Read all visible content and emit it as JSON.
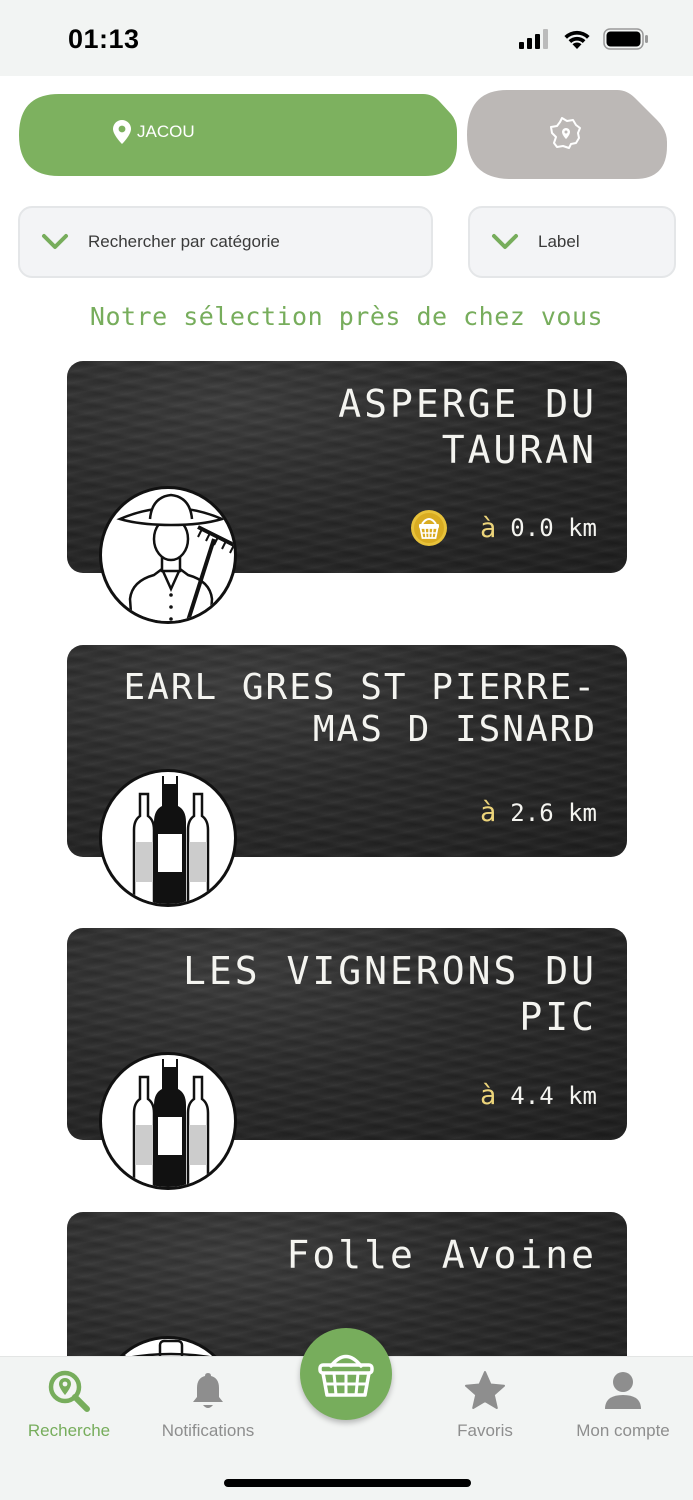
{
  "status_bar": {
    "time": "01:13"
  },
  "location": {
    "label": "JACOU"
  },
  "filters": {
    "category": "Rechercher par catégorie",
    "label": "Label"
  },
  "section_title": "Notre sélection près de chez vous",
  "producers": [
    {
      "name_line1": "ASPERGE DU",
      "name_line2": "TAURAN",
      "distance_prefix": "à",
      "distance": "0.0 km",
      "badge_icon": "farmer-icon",
      "has_basket": true
    },
    {
      "name_line1": "EARL GRES ST PIERRE-",
      "name_line2": "MAS D ISNARD",
      "distance_prefix": "à",
      "distance": "2.6 km",
      "badge_icon": "wine-bottles-icon",
      "has_basket": false
    },
    {
      "name_line1": "LES VIGNERONS DU",
      "name_line2": "PIC",
      "distance_prefix": "à",
      "distance": "4.4 km",
      "badge_icon": "wine-bottles-icon",
      "has_basket": false
    },
    {
      "name_line1": "Folle Avoine",
      "name_line2": "",
      "badge_icon": "producer-icon"
    }
  ],
  "nav": {
    "search": "Recherche",
    "notifications": "Notifications",
    "favorites": "Favoris",
    "account": "Mon compte"
  },
  "colors": {
    "accent_green": "#77ad5c",
    "location_button": "#7db15f",
    "france_button": "#bcb8b6",
    "card_slate": "#2a2a2a",
    "distance_accent": "#ecd47a",
    "nav_inactive": "#8e8e8e"
  }
}
